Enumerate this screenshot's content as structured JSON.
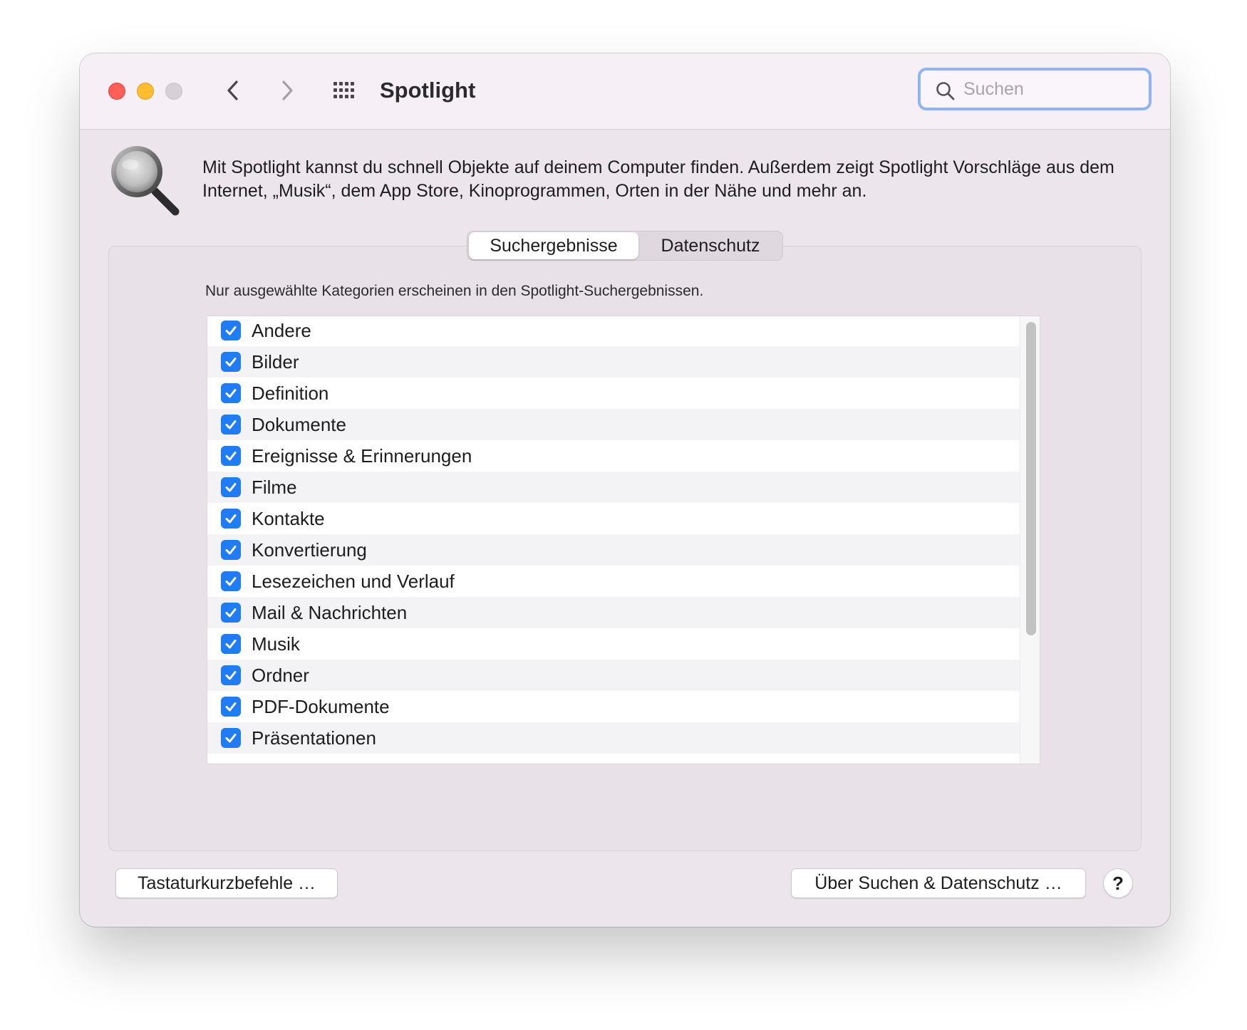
{
  "window": {
    "title": "Spotlight"
  },
  "search": {
    "placeholder": "Suchen",
    "value": ""
  },
  "description": "Mit Spotlight kannst du schnell Objekte auf deinem Computer finden. Außerdem zeigt Spotlight Vorschläge aus dem Internet, „Musik“, dem App Store, Kinoprogrammen, Orten in der Nähe und mehr an.",
  "tabs": [
    {
      "label": "Suchergebnisse",
      "selected": true
    },
    {
      "label": "Datenschutz",
      "selected": false
    }
  ],
  "hint": "Nur ausgewählte Kategorien erscheinen in den Spotlight-Suchergebnissen.",
  "categories": [
    {
      "label": "Andere",
      "checked": true
    },
    {
      "label": "Bilder",
      "checked": true
    },
    {
      "label": "Definition",
      "checked": true
    },
    {
      "label": "Dokumente",
      "checked": true
    },
    {
      "label": "Ereignisse & Erinnerungen",
      "checked": true
    },
    {
      "label": "Filme",
      "checked": true
    },
    {
      "label": "Kontakte",
      "checked": true
    },
    {
      "label": "Konvertierung",
      "checked": true
    },
    {
      "label": "Lesezeichen und Verlauf",
      "checked": true
    },
    {
      "label": "Mail & Nachrichten",
      "checked": true
    },
    {
      "label": "Musik",
      "checked": true
    },
    {
      "label": "Ordner",
      "checked": true
    },
    {
      "label": "PDF-Dokumente",
      "checked": true
    },
    {
      "label": "Präsentationen",
      "checked": true
    }
  ],
  "buttons": {
    "shortcuts": "Tastaturkurzbefehle …",
    "privacy": "Über Suchen & Datenschutz …",
    "help": "?"
  },
  "colors": {
    "accent": "#1f7cf5",
    "close": "#fe5f57",
    "minimize": "#febc2e",
    "zoom_disabled": "#d7d1d7",
    "search_focus": "#8fb3f5"
  },
  "icons": {
    "back": "chevron-left-icon",
    "forward": "chevron-right-icon",
    "show_all": "grid-icon",
    "search": "magnifier-icon",
    "pane": "spotlight-magnifier-icon",
    "checkbox": "checkmark-icon"
  }
}
